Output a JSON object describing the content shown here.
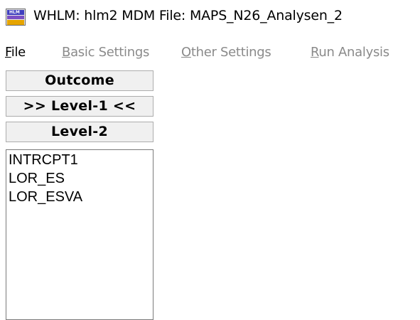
{
  "window": {
    "title": "WHLM: hlm2 MDM File: MAPS_N26_Analysen_2",
    "icon": "hlm-app-icon",
    "icon_text": "HLM"
  },
  "menu": {
    "items": [
      {
        "label_mnemonic": "F",
        "label_rest": "ile",
        "enabled": true
      },
      {
        "label_mnemonic": "B",
        "label_rest": "asic Settings",
        "enabled": false
      },
      {
        "label_mnemonic": "O",
        "label_rest": "ther Settings",
        "enabled": false
      },
      {
        "label_mnemonic": "R",
        "label_rest": "un Analysis",
        "enabled": false
      }
    ]
  },
  "panel": {
    "outcome_label": "Outcome",
    "level1_label": ">> Level-1 <<",
    "level2_label": "Level-2",
    "variables": [
      "INTRCPT1",
      "LOR_ES",
      "LOR_ESVA"
    ]
  },
  "colors": {
    "button_face": "#f0f0f0",
    "disabled_text": "#8a8a8a"
  }
}
